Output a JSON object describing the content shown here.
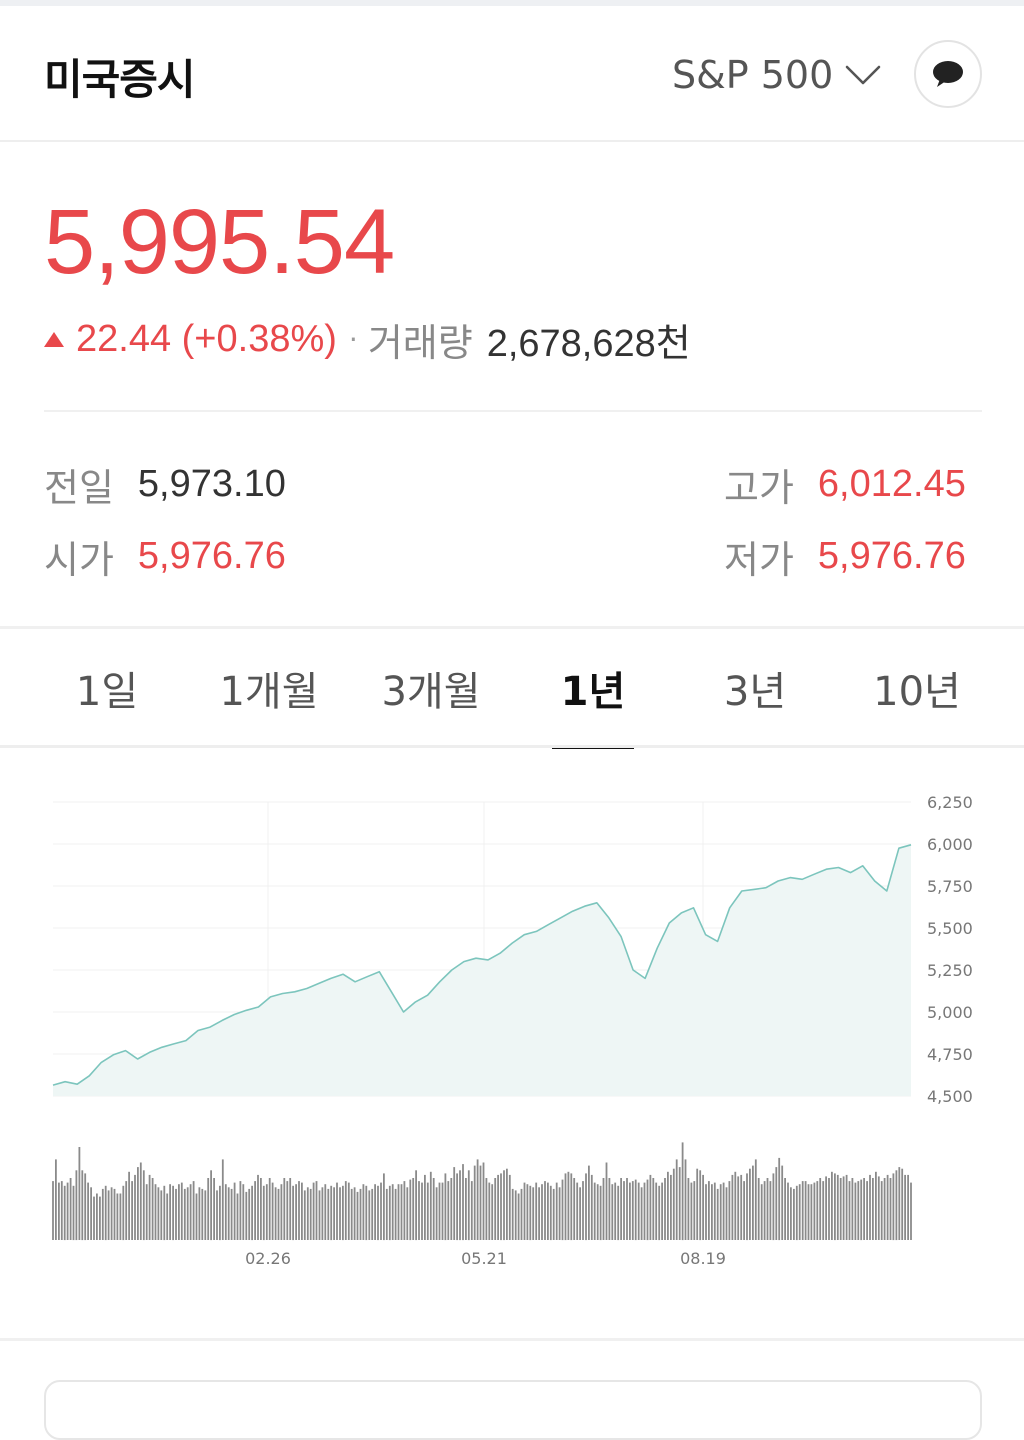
{
  "header": {
    "title": "미국증시",
    "index_selector": "S&P 500",
    "chat_icon": "speech-bubble-icon"
  },
  "quote": {
    "price": "5,995.54",
    "change": "22.44 (+0.38%)",
    "direction_icon": "up-triangle-icon",
    "separator": "·",
    "volume_label": "거래량",
    "volume_value": "2,678,628천"
  },
  "stats": {
    "prev_close": {
      "label": "전일",
      "value": "5,973.10"
    },
    "open": {
      "label": "시가",
      "value": "5,976.76"
    },
    "high": {
      "label": "고가",
      "value": "6,012.45"
    },
    "low": {
      "label": "저가",
      "value": "5,976.76"
    }
  },
  "tabs": [
    {
      "label": "1일",
      "active": false
    },
    {
      "label": "1개월",
      "active": false
    },
    {
      "label": "3개월",
      "active": false
    },
    {
      "label": "1년",
      "active": true
    },
    {
      "label": "3년",
      "active": false
    },
    {
      "label": "10년",
      "active": false
    }
  ],
  "colors": {
    "up": "#e8484b",
    "line": "#7cc5bd",
    "area": "#eef6f5",
    "volume": "#8a8a8a"
  },
  "chart_data": {
    "type": "area",
    "y_ticks": [
      "6,250",
      "6,000",
      "5,750",
      "5,500",
      "5,250",
      "5,000",
      "4,750",
      "4,500"
    ],
    "ylim": [
      4500,
      6250
    ],
    "x_ticks": [
      "02.26",
      "05.21",
      "08.19"
    ],
    "series": [
      {
        "values": [
          4565,
          4585,
          4570,
          4620,
          4700,
          4745,
          4770,
          4720,
          4760,
          4790,
          4810,
          4830,
          4890,
          4910,
          4950,
          4985,
          5010,
          5030,
          5090,
          5110,
          5120,
          5140,
          5170,
          5200,
          5225,
          5180,
          5210,
          5240,
          5120,
          5000,
          5060,
          5100,
          5180,
          5250,
          5300,
          5320,
          5310,
          5350,
          5410,
          5460,
          5480,
          5520,
          5560,
          5600,
          5630,
          5650,
          5560,
          5450,
          5250,
          5200,
          5380,
          5530,
          5590,
          5620,
          5460,
          5420,
          5620,
          5720,
          5730,
          5740,
          5780,
          5800,
          5790,
          5820,
          5850,
          5860,
          5830,
          5870,
          5780,
          5720,
          5975,
          5995
        ]
      }
    ],
    "volume": [
      38,
      52,
      37,
      38,
      35,
      37,
      40,
      35,
      45,
      60,
      45,
      43,
      37,
      34,
      28,
      30,
      28,
      33,
      35,
      32,
      34,
      33,
      30,
      30,
      35,
      38,
      44,
      38,
      42,
      47,
      50,
      45,
      36,
      42,
      40,
      36,
      34,
      32,
      35,
      30,
      36,
      35,
      33,
      36,
      37,
      33,
      34,
      36,
      38,
      30,
      34,
      33,
      32,
      40,
      45,
      40,
      32,
      35,
      52,
      36,
      34,
      33,
      37,
      30,
      38,
      36,
      31,
      33,
      35,
      38,
      42,
      40,
      35,
      36,
      40,
      37,
      34,
      33,
      36,
      40,
      38,
      40,
      35,
      36,
      38,
      37,
      32,
      34,
      33,
      37,
      38,
      32,
      34,
      36,
      33,
      35,
      34,
      37,
      34,
      35,
      38,
      37,
      33,
      34,
      31,
      33,
      36,
      35,
      32,
      33,
      36,
      35,
      37,
      43,
      33,
      35,
      36,
      33,
      36,
      36,
      38,
      34,
      39,
      40,
      45,
      38,
      37,
      42,
      37,
      44,
      40,
      34,
      37,
      37,
      43,
      38,
      40,
      47,
      43,
      45,
      49,
      40,
      45,
      38,
      48,
      52,
      48,
      50,
      40,
      37,
      36,
      40,
      42,
      43,
      45,
      46,
      42,
      33,
      32,
      30,
      33,
      37,
      36,
      35,
      34,
      37,
      34,
      36,
      38,
      37,
      35,
      33,
      37,
      34,
      39,
      43,
      44,
      43,
      40,
      37,
      34,
      38,
      43,
      48,
      42,
      37,
      36,
      35,
      40,
      50,
      40,
      36,
      37,
      35,
      40,
      38,
      40,
      37,
      38,
      39,
      37,
      34,
      37,
      39,
      42,
      40,
      37,
      35,
      37,
      40,
      44,
      42,
      46,
      52,
      47,
      63,
      52,
      40,
      37,
      38,
      46,
      45,
      42,
      36,
      38,
      36,
      37,
      33,
      36,
      37,
      34,
      38,
      42,
      44,
      41,
      42,
      38,
      43,
      46,
      48,
      52,
      40,
      36,
      38,
      40,
      38,
      43,
      47,
      53,
      48,
      40,
      37,
      34,
      33,
      35,
      36,
      38,
      38,
      36,
      36,
      37,
      38,
      40,
      38,
      41,
      40,
      44,
      43,
      42,
      40,
      41,
      42,
      38,
      40,
      37,
      38,
      39,
      40,
      38,
      42,
      40,
      44,
      41,
      38,
      40,
      42,
      40,
      43,
      45,
      47,
      46,
      42,
      42,
      37
    ]
  }
}
